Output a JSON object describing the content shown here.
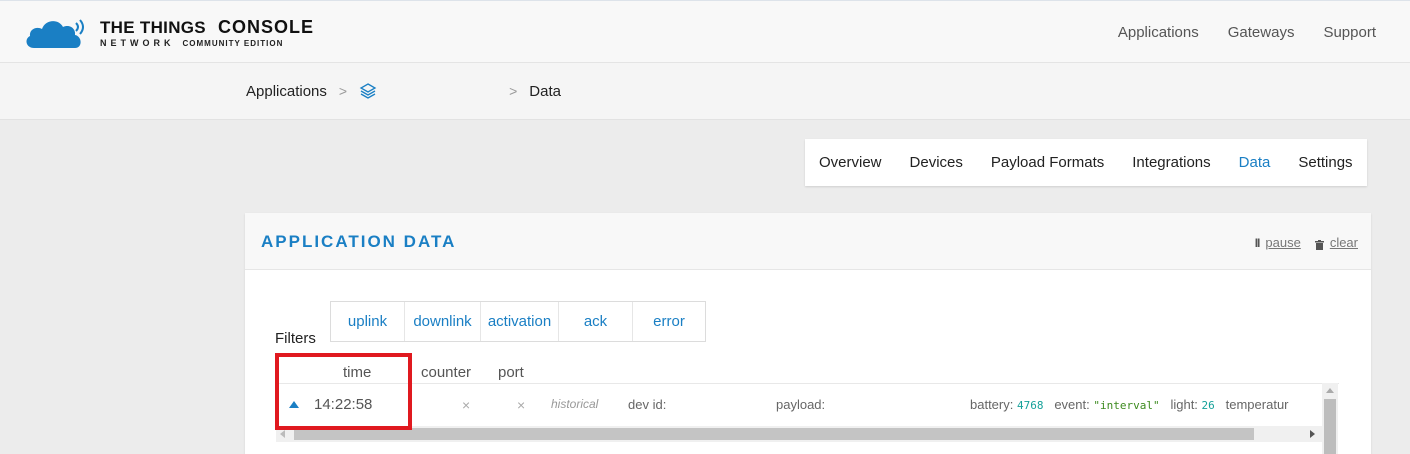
{
  "header": {
    "brand_line1": "THE THINGS",
    "brand_console": "CONSOLE",
    "brand_line2": "NETWORK",
    "brand_edition": "COMMUNITY EDITION",
    "nav": [
      "Applications",
      "Gateways",
      "Support"
    ],
    "accent_color": "#1a7fc4"
  },
  "breadcrumb": {
    "items": [
      "Applications",
      "Data"
    ],
    "icon": "layers-icon"
  },
  "tabs": {
    "items": [
      "Overview",
      "Devices",
      "Payload Formats",
      "Integrations",
      "Data",
      "Settings"
    ],
    "active": "Data"
  },
  "panel": {
    "title": "APPLICATION DATA",
    "pause_label": "pause",
    "clear_label": "clear",
    "filters_label": "Filters",
    "filters": [
      "uplink",
      "downlink",
      "activation",
      "ack",
      "error"
    ],
    "columns": {
      "time": "time",
      "counter": "counter",
      "port": "port"
    },
    "row": {
      "time": "14:22:58",
      "counter": "×",
      "port": "×",
      "tag": "historical",
      "dev_id_label": "dev id:",
      "payload_label": "payload:",
      "fields": [
        {
          "key": "battery:",
          "value": "4768"
        },
        {
          "key": "event:",
          "value": "\"interval\""
        },
        {
          "key": "light:",
          "value": "26"
        },
        {
          "key": "temperatur",
          "value": ""
        }
      ]
    }
  }
}
